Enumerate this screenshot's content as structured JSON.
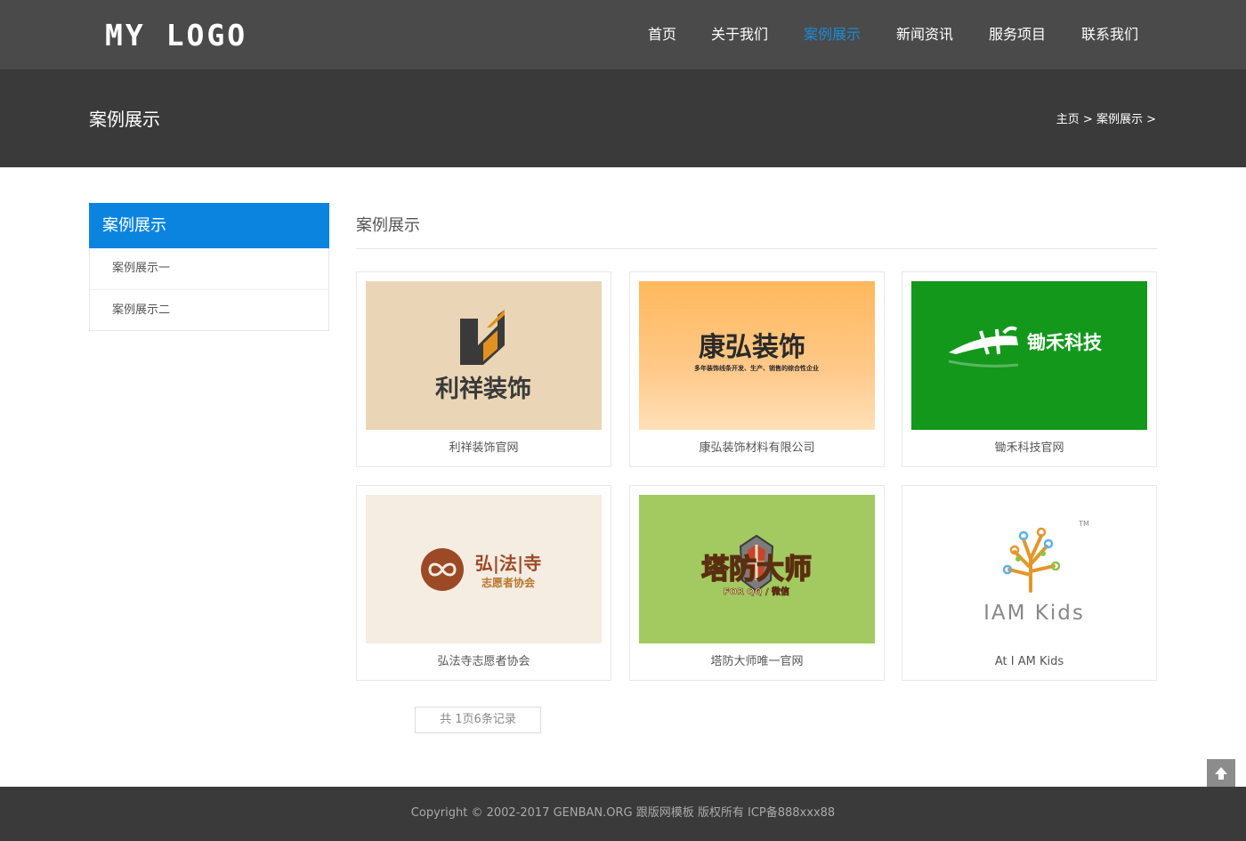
{
  "header": {
    "logo": "MY LOGO",
    "nav": [
      {
        "label": "首页"
      },
      {
        "label": "关于我们"
      },
      {
        "label": "案例展示"
      },
      {
        "label": "新闻资讯"
      },
      {
        "label": "服务项目"
      },
      {
        "label": "联系我们"
      }
    ],
    "active_index": 2
  },
  "banner": {
    "title": "案例展示",
    "breadcrumb": [
      {
        "label": "主页"
      },
      {
        "label": "案例展示"
      }
    ],
    "separator": ">"
  },
  "sidebar": {
    "title": "案例展示",
    "items": [
      {
        "label": "案例展示一"
      },
      {
        "label": "案例展示二"
      }
    ]
  },
  "main": {
    "title": "案例展示",
    "cases": [
      {
        "caption": "利祥装饰官网",
        "logo_text": "利祥装饰",
        "logo_sub": "",
        "bg": "#ead6b6"
      },
      {
        "caption": "康弘装饰材料有限公司",
        "logo_text": "康弘装饰",
        "logo_sub": "多年装饰线条开发、生产、销售的综合性企业",
        "bg": "#ffc078"
      },
      {
        "caption": "锄禾科技官网",
        "logo_text": "锄禾科技",
        "logo_sub": "",
        "bg": "#13981c"
      },
      {
        "caption": "弘法寺志愿者协会",
        "logo_text": "弘|法|寺",
        "logo_sub": "志愿者协会",
        "bg": "#f5ece2"
      },
      {
        "caption": "塔防大师唯一官网",
        "logo_text": "塔防大师",
        "logo_sub": "FOR QQ / 微信",
        "bg": "#a3c961"
      },
      {
        "caption": "At I AM Kids",
        "logo_text": "IAM Kids",
        "logo_sub": "TM",
        "bg": "#ffffff"
      }
    ]
  },
  "pager": {
    "text": "共 1页6条记录"
  },
  "footer": {
    "text": "Copyright © 2002-2017 GENBAN.ORG 跟版网模板 版权所有  ICP备888xxx88"
  },
  "colors": {
    "accent": "#0b84e0",
    "nav_active": "#1a8cd8",
    "header_bg": "#4a4a4a",
    "banner_bg": "#3a3a3a"
  }
}
